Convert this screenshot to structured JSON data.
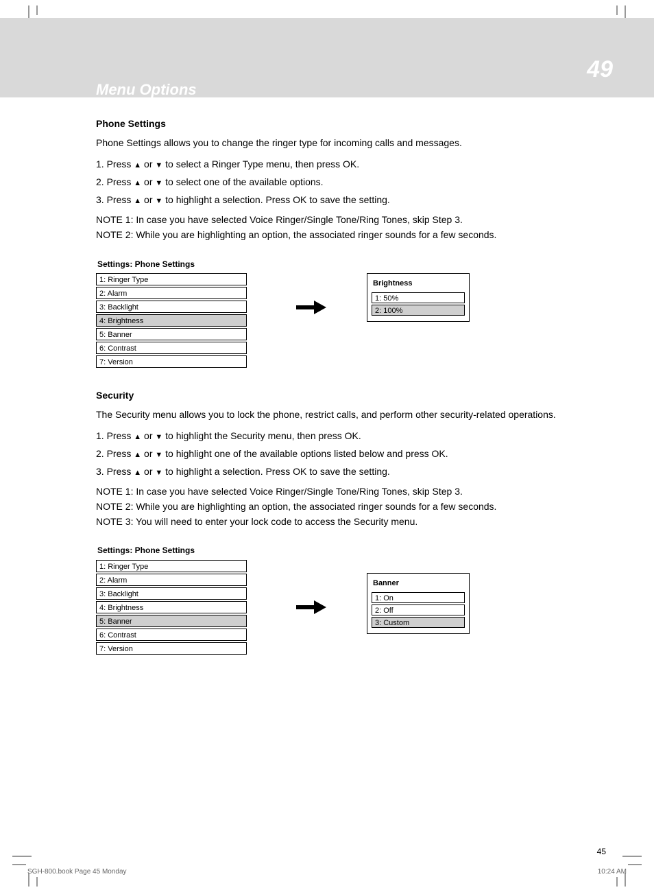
{
  "header": {
    "page_number": "49",
    "title": "Menu Options"
  },
  "sec1": {
    "h": "Phone Settings",
    "p": "Phone Settings allows you to change the ringer type for incoming calls and messages.",
    "s1_pre": "1.   Press ",
    "s1_mid": " or ",
    "s1_post": " to select a Ringer Type menu, then press OK.",
    "s2_pre": "2.   Press ",
    "s2_mid": " or ",
    "s2_post": " to select one of the available options.",
    "s3_pre": "3.   Press ",
    "s3_mid": " or ",
    "s3_post": " to highlight a selection. Press OK to save the setting.",
    "note1": "NOTE 1: In case you have selected Voice Ringer/Single Tone/Ring Tones, skip Step 3.",
    "note2": "NOTE 2: While you are highlighting an option, the associated ringer sounds for a few seconds."
  },
  "menu_left_1": {
    "title": "Settings: Phone Settings",
    "rows": [
      {
        "label": "1: Ringer Type",
        "sel": false
      },
      {
        "label": "2: Alarm",
        "sel": false
      },
      {
        "label": "3: Backlight",
        "sel": false
      },
      {
        "label": "4: Brightness",
        "sel": true
      },
      {
        "label": "5: Banner",
        "sel": false
      },
      {
        "label": "6: Contrast",
        "sel": false
      },
      {
        "label": "7: Version",
        "sel": false
      }
    ]
  },
  "menu_right_1": {
    "title": "Brightness",
    "rows": [
      {
        "label": "1: 50%",
        "sel": false
      },
      {
        "label": "2: 100%",
        "sel": true
      }
    ]
  },
  "sec2": {
    "h": "Security",
    "p": "The Security menu allows you to lock the phone, restrict calls, and perform other security-related operations.",
    "s1_pre": "1.   Press ",
    "s1_mid": " or ",
    "s1_post": " to highlight the Security menu, then press OK.",
    "s2_pre": "2.   Press ",
    "s2_mid": " or ",
    "s2_post": " to highlight one of the available options listed below and press OK.",
    "s3_pre": "3.   Press ",
    "s3_mid": " or ",
    "s3_post": " to highlight a selection. Press OK to save the setting.",
    "note1": "NOTE 1: In case you have selected Voice Ringer/Single Tone/Ring Tones, skip Step 3.",
    "note2": "NOTE 2: While you are highlighting an option, the associated ringer sounds for a few seconds.",
    "note3": "NOTE 3: You will need to enter your lock code to access the Security menu."
  },
  "menu_left_2": {
    "title": "Settings: Phone Settings",
    "rows": [
      {
        "label": "1: Ringer Type",
        "sel": false
      },
      {
        "label": "2: Alarm",
        "sel": false
      },
      {
        "label": "3: Backlight",
        "sel": false
      },
      {
        "label": "4: Brightness",
        "sel": false
      },
      {
        "label": "5: Banner",
        "sel": true
      },
      {
        "label": "6: Contrast",
        "sel": false
      },
      {
        "label": "7: Version",
        "sel": false
      }
    ]
  },
  "menu_right_2": {
    "title": "Banner",
    "rows": [
      {
        "label": "1: On",
        "sel": false
      },
      {
        "label": "2: Off",
        "sel": false
      },
      {
        "label": "3: Custom",
        "sel": true
      }
    ]
  },
  "footer": {
    "page_label": "45",
    "left": "SGH-800.book  Page 45  Monday",
    "right": "10:24 AM"
  }
}
